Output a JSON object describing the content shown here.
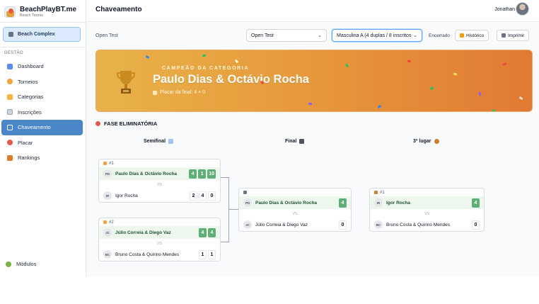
{
  "app": {
    "name": "BeachPlayBT.me",
    "subtitle": "Beach Tennis"
  },
  "sidebar": {
    "complex_label": "Beach Complex",
    "section_label": "GESTÃO",
    "items": [
      {
        "label": "Dashboard",
        "icon": "bar-chart-icon",
        "color": "#5b8def"
      },
      {
        "label": "Torneios",
        "icon": "medal-icon",
        "color": "#f0a43a"
      },
      {
        "label": "Categorias",
        "icon": "folder-icon",
        "color": "#f4b63f"
      },
      {
        "label": "Inscrições",
        "icon": "clipboard-icon",
        "color": "#9ca3af"
      },
      {
        "label": "Chaveamento",
        "icon": "bracket-icon",
        "color": "#ffffff",
        "active": true
      },
      {
        "label": "Placar",
        "icon": "target-icon",
        "color": "#e55a4e"
      },
      {
        "label": "Rankings",
        "icon": "trophy-icon",
        "color": "#e07a2e"
      }
    ],
    "modules_label": "Módulos"
  },
  "header": {
    "title": "Chaveamento",
    "user_name": "Jonathan"
  },
  "filters": {
    "tournament_label": "Open Test",
    "tournament_select": "Open Test",
    "category_select": "Masculina A (4 duplas / 8 inscritos",
    "status": "Encerrado",
    "history_button": "Histórico",
    "print_button": "Imprimir"
  },
  "champion": {
    "kicker": "CAMPEÃO DA CATEGORIA",
    "names": "Paulo Dias & Octávio Rocha",
    "final_score": "Placar da final: 4 × 0"
  },
  "bracket": {
    "section_title": "FASE ELIMINATÓRIA",
    "rounds": {
      "semifinal": "Semifinal",
      "final": "Final",
      "third": "3º lugar"
    },
    "vs_label": "VS",
    "semifinal_1": {
      "label": "#1",
      "team_a": {
        "initials": "PD",
        "name": "Paulo Dias & Octávio Rocha",
        "scores": [
          "4",
          "1",
          "10"
        ]
      },
      "team_b": {
        "initials": "IR",
        "name": "Igor Rocha",
        "scores": [
          "2",
          "4",
          "0"
        ]
      }
    },
    "semifinal_2": {
      "label": "#2",
      "team_a": {
        "initials": "JC",
        "name": "Júlio Correia & Diego Vaz",
        "scores": [
          "4",
          "4"
        ]
      },
      "team_b": {
        "initials": "BC",
        "name": "Bruno Costa & Quirino Mendes",
        "scores": [
          "1",
          "1"
        ]
      }
    },
    "final": {
      "team_a": {
        "initials": "PD",
        "name": "Paulo Dias & Octávio Rocha",
        "score": "4"
      },
      "team_b": {
        "initials": "JC",
        "name": "Júlio Correia & Diego Vaz",
        "score": "0"
      }
    },
    "third_place": {
      "label": "#1",
      "team_a": {
        "initials": "IR",
        "name": "Igor Rocha",
        "score": "4"
      },
      "team_b": {
        "initials": "BC",
        "name": "Bruno Costa & Quirino Mendes",
        "score": "0"
      }
    }
  }
}
